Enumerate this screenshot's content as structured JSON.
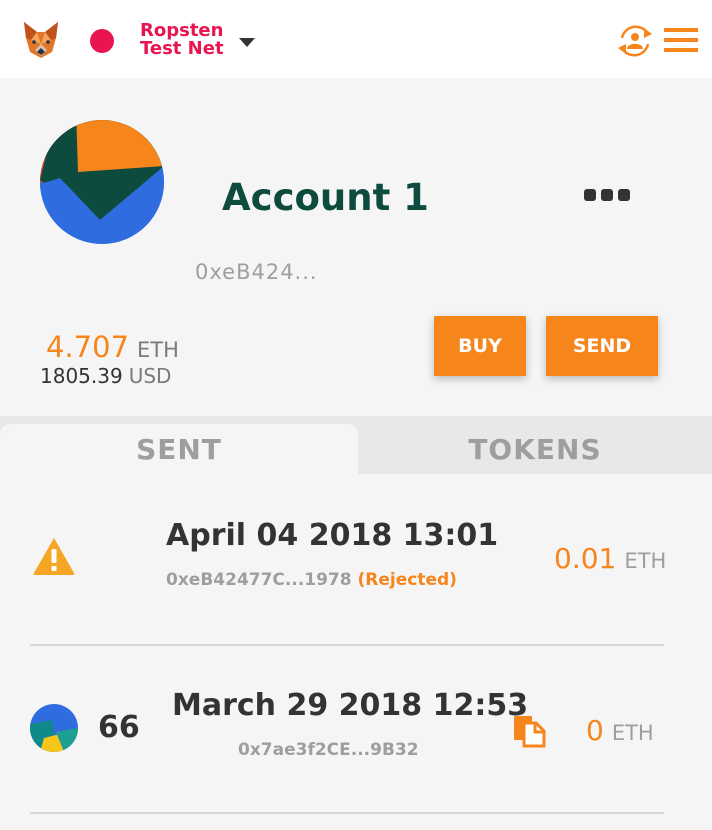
{
  "header": {
    "network_line1": "Ropsten",
    "network_line2": "Test Net",
    "network_color": "#e91550",
    "icons": [
      "metamask-fox-icon",
      "network-dot",
      "chevron-down-icon",
      "account-switch-icon",
      "hamburger-menu-icon"
    ]
  },
  "account": {
    "name": "Account 1",
    "address": "0xeB424...",
    "balance_eth": "4.707",
    "eth_unit": "ETH",
    "balance_usd": "1805.39",
    "usd_unit": "USD",
    "buy_label": "BUY",
    "send_label": "SEND"
  },
  "tabs": [
    {
      "label": "SENT",
      "active": true
    },
    {
      "label": "TOKENS",
      "active": false
    }
  ],
  "transactions": [
    {
      "date": "April 04 2018 13:01",
      "address": "0xeB42477C...1978",
      "status": "(Rejected)",
      "amount": "0.01",
      "unit": "ETH",
      "icon": "warning-icon"
    },
    {
      "nonce": "66",
      "date": "March 29 2018 12:53",
      "address": "0x7ae3f2CE...9B32",
      "amount": "0",
      "unit": "ETH",
      "icon": "copy-icon"
    }
  ],
  "colors": {
    "accent": "#f6851b",
    "account_name": "#0e4b3f",
    "background": "#f5f5f5"
  }
}
